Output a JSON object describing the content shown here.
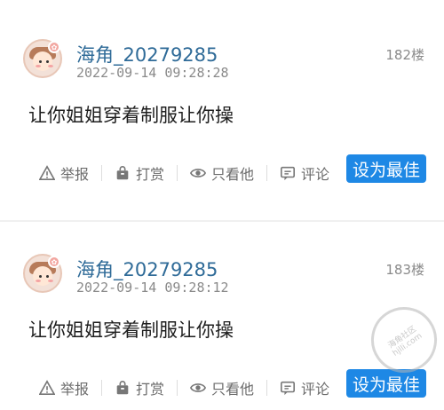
{
  "posts": [
    {
      "username": "海角_20279285",
      "time": "2022-09-14 09:28:28",
      "floor": "182楼",
      "content": "让你姐姐穿着制服让你操",
      "actions": {
        "report": "举报",
        "reward": "打赏",
        "only_him": "只看他",
        "comment": "评论"
      },
      "best_button": "设为最佳"
    },
    {
      "username": "海角_20279285",
      "time": "2022-09-14 09:28:12",
      "floor": "183楼",
      "content": "让你姐姐穿着制服让你操",
      "actions": {
        "report": "举报",
        "reward": "打赏",
        "only_him": "只看他",
        "comment": "评论"
      },
      "best_button": "设为最佳"
    }
  ],
  "icons": [
    "warning-icon",
    "gift-bag-icon",
    "eye-icon",
    "comment-icon"
  ],
  "colors": {
    "username": "#2f6b98",
    "best_button": "#1e88e5",
    "meta": "#8a8a8a"
  }
}
